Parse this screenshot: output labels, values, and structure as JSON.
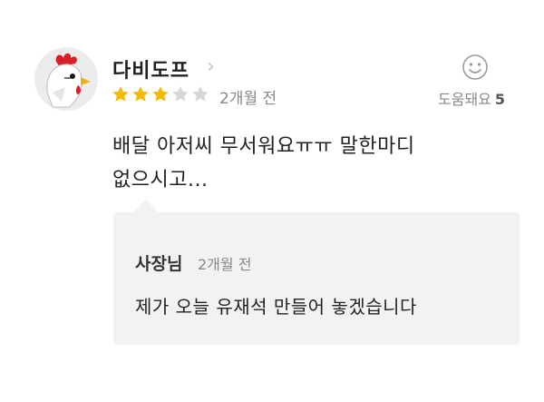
{
  "review": {
    "username": "다비도프",
    "chevron": "›",
    "rating": 3,
    "max_rating": 5,
    "time": "2개월 전",
    "helpful_label": "도움돼요",
    "helpful_count": "5",
    "text_line1": "배달 아저씨 무서워요ㅠㅠ 말한마디",
    "text_line2": "없으시고...",
    "star_color": "#f5b900",
    "star_empty_color": "#d6d6d6"
  },
  "reply": {
    "author": "사장님",
    "time": "2개월 전",
    "text": "제가 오늘 유재석 만들어 놓겠습니다"
  },
  "icons": {
    "avatar": "rooster-avatar",
    "chevron": "chevron-right-icon",
    "helpful": "smile-icon"
  }
}
